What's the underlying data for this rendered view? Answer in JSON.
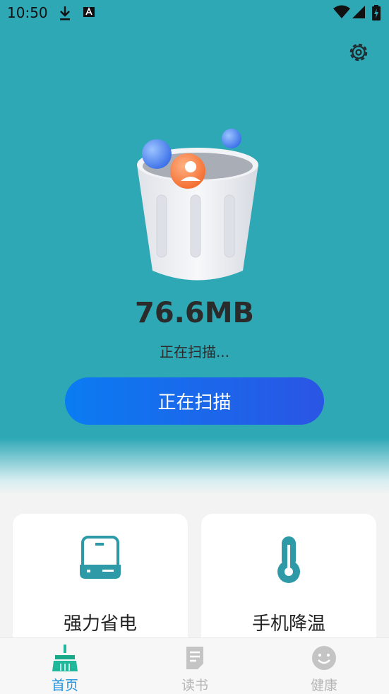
{
  "status_bar": {
    "time": "10:50",
    "icons": [
      "download-icon",
      "keyboard-icon",
      "wifi-icon",
      "signal-icon",
      "battery-charging-icon"
    ]
  },
  "header": {
    "settings_icon": "gear-icon"
  },
  "scan": {
    "size": "76.6MB",
    "status": "正在扫描...",
    "button_label": "正在扫描"
  },
  "features": [
    {
      "label": "强力省电",
      "icon": "battery-icon"
    },
    {
      "label": "手机降温",
      "icon": "thermometer-icon"
    }
  ],
  "tabs": [
    {
      "label": "首页",
      "icon": "broom-icon",
      "active": true
    },
    {
      "label": "读书",
      "icon": "document-icon",
      "active": false
    },
    {
      "label": "健康",
      "icon": "smiley-icon",
      "active": false
    }
  ],
  "colors": {
    "hero_bg": "#2fa8b6",
    "button_gradient_start": "#0a7cf2",
    "button_gradient_end": "#2a55e4",
    "active_tab": "#1e8fdc",
    "inactive_tab": "#b5b5b5",
    "accent_teal": "#2e9aa8"
  }
}
